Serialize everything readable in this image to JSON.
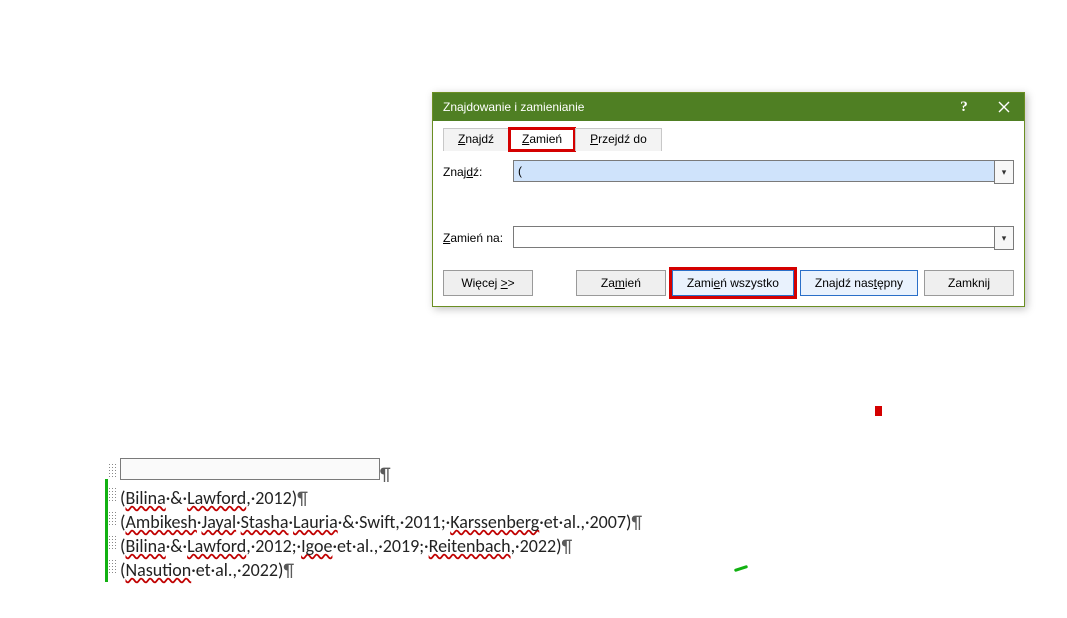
{
  "dialog": {
    "title": "Znajdowanie i zamienianie",
    "tabs": {
      "find": "Znajdź",
      "replace": "Zamień",
      "goto": "Przejdź do"
    },
    "labels": {
      "find": "Znajdź:",
      "replace": "Zamień na:"
    },
    "inputs": {
      "find_value": "(",
      "replace_value": ""
    },
    "buttons": {
      "more": "Więcej >>",
      "replace": "Zamień",
      "replace_all": "Zamień wszystko",
      "find_next": "Znajdź następny",
      "close": "Zamknij"
    }
  },
  "doc": {
    "lines": [
      {
        "type": "fieldbox"
      },
      {
        "type": "cite",
        "text": "(Bilina·&·Lawford,·2012)",
        "wavy": [
          "Bilina",
          "Lawford"
        ]
      },
      {
        "type": "cite",
        "text": "(Ambikesh·Jayal·Stasha·Lauria·&·Swift,·2011;·Karssenberg·et·al.,·2007)",
        "wavy": [
          "Ambikesh",
          "Jayal",
          "Stasha",
          "Lauria",
          "Karssenberg"
        ]
      },
      {
        "type": "cite",
        "text": "(Bilina·&·Lawford,·2012;·Igoe·et·al.,·2019;·Reitenbach,·2022)",
        "wavy": [
          "Bilina",
          "Lawford",
          "Igoe",
          "Reitenbach"
        ]
      },
      {
        "type": "cite",
        "text": "(Nasution·et·al.,·2022)",
        "wavy": [
          "Nasution"
        ]
      }
    ]
  }
}
